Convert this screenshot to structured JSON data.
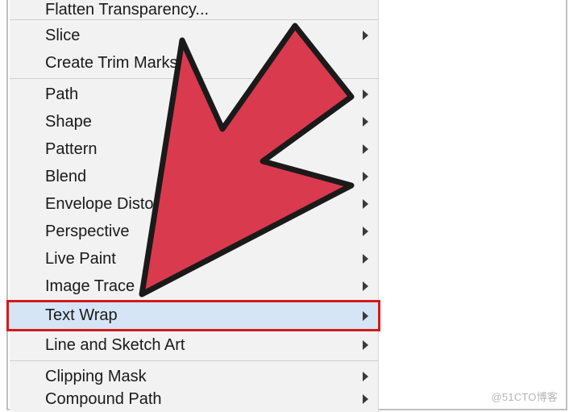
{
  "menu": {
    "group1": {
      "flatten": "Flatten Transparency..."
    },
    "group2": {
      "slice": "Slice",
      "trim": "Create Trim Marks"
    },
    "group3": {
      "path": "Path",
      "shape": "Shape",
      "pattern": "Pattern",
      "blend": "Blend",
      "envelope": "Envelope Distort",
      "perspective": "Perspective",
      "livepaint": "Live Paint",
      "imagetrace": "Image Trace",
      "textwrap": "Text Wrap",
      "linesketch": "Line and Sketch Art"
    },
    "group4": {
      "clipping": "Clipping Mask",
      "compound": "Compound Path"
    }
  },
  "watermark": "@51CTO博客",
  "highlight": "textwrap",
  "arrow_color": "#d93a4e",
  "arrow_stroke": "#1a1a1a"
}
